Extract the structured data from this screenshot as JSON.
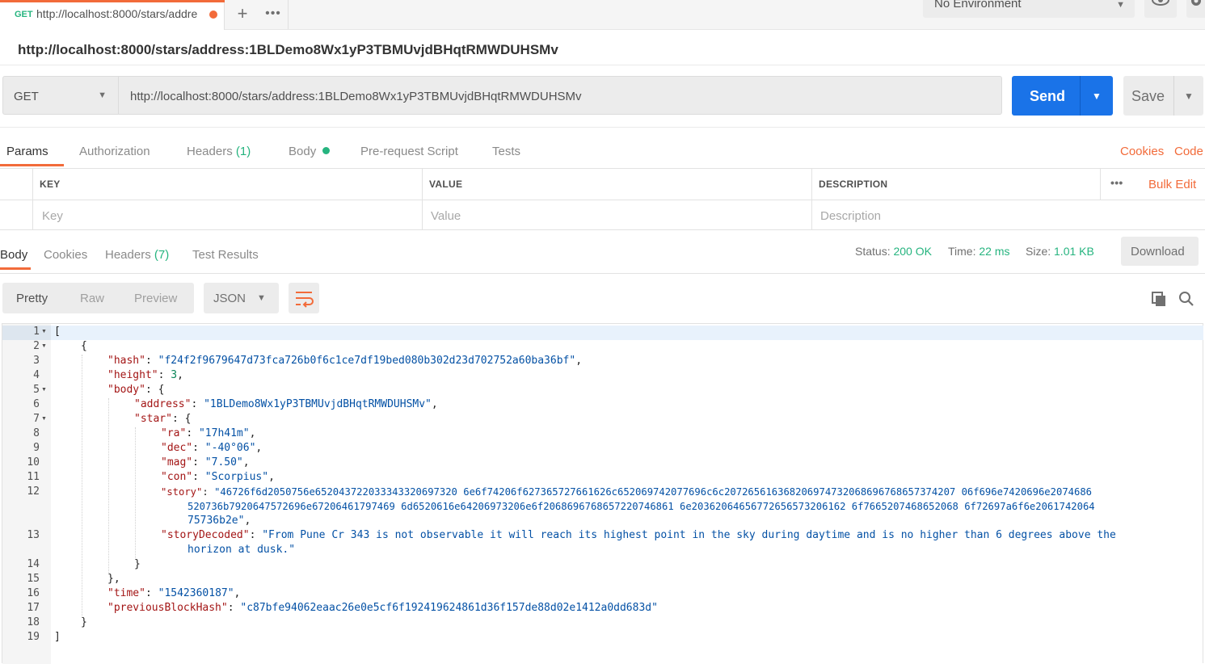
{
  "tabbar": {
    "tab_method": "GET",
    "tab_url": "http://localhost:8000/stars/addre",
    "plus_label": "+",
    "more_label": "•••",
    "environment": "No Environment"
  },
  "page_title": "http://localhost:8000/stars/address:1BLDemo8Wx1yP3TBMUvjdBHqtRMWDUHSMv",
  "request": {
    "method": "GET",
    "url": "http://localhost:8000/stars/address:1BLDemo8Wx1yP3TBMUvjdBHqtRMWDUHSMv",
    "send_label": "Send",
    "save_label": "Save"
  },
  "request_tabs": {
    "params": "Params",
    "authorization": "Authorization",
    "headers": "Headers",
    "headers_count": "(1)",
    "body": "Body",
    "prerequest": "Pre-request Script",
    "tests": "Tests",
    "cookies": "Cookies",
    "code": "Code"
  },
  "params_table": {
    "col_key": "KEY",
    "col_value": "VALUE",
    "col_description": "DESCRIPTION",
    "more": "•••",
    "bulk_edit": "Bulk Edit",
    "ph_key": "Key",
    "ph_value": "Value",
    "ph_description": "Description"
  },
  "response_tabs": {
    "body": "Body",
    "cookies": "Cookies",
    "headers": "Headers",
    "headers_count": "(7)",
    "test_results": "Test Results"
  },
  "response_status": {
    "status_label": "Status:",
    "status_value": "200 OK",
    "time_label": "Time:",
    "time_value": "22 ms",
    "size_label": "Size:",
    "size_value": "1.01 KB",
    "download_label": "Download"
  },
  "view_toolbar": {
    "pretty": "Pretty",
    "raw": "Raw",
    "preview": "Preview",
    "format": "JSON"
  },
  "code": {
    "line_numbers": [
      "1",
      "2",
      "3",
      "4",
      "5",
      "6",
      "7",
      "8",
      "9",
      "10",
      "11",
      "12",
      "13",
      "14",
      "15",
      "16",
      "17",
      "18",
      "19"
    ],
    "l1": "[",
    "l2": "{",
    "hash_key": "\"hash\"",
    "hash_val": "\"f24f2f9679647d73fca726b0f6c1ce7df19bed080b302d23d702752a60ba36bf\"",
    "height_key": "\"height\"",
    "height_val": "3",
    "body_key": "\"body\"",
    "address_key": "\"address\"",
    "address_val": "\"1BLDemo8Wx1yP3TBMUvjdBHqtRMWDUHSMv\"",
    "star_key": "\"star\"",
    "ra_key": "\"ra\"",
    "ra_val": "\"17h41m\"",
    "dec_key": "\"dec\"",
    "dec_val": "\"-40°06\"",
    "mag_key": "\"mag\"",
    "mag_val": "\"7.50\"",
    "con_key": "\"con\"",
    "con_val": "\"Scorpius\"",
    "story_key": "\"story\"",
    "story_val_1": "\"46726f6d2050756e652043722033343320697320 6e6f74206f627365727661626c652069742077696c6c207265616368206974732068696768657374207 06f696e7420696e2074686",
    "story_val_2": "520736b7920647572696e67206461797469 6d6520616e64206973206e6f2068696768657220746861 6e20362064656772656573206162 6f7665207468652068 6f72697a6f6e2061742064",
    "story_val_3": "75736b2e\"",
    "storydecoded_key": "\"storyDecoded\"",
    "storydecoded_val_1": "\"From Pune Cr 343 is not observable it will reach its highest point in the sky during daytime and is no higher than 6 degrees above the",
    "storydecoded_val_2": "horizon at dusk.\"",
    "l14": "}",
    "l15": "},",
    "time_key": "\"time\"",
    "time_val": "\"1542360187\"",
    "prev_key": "\"previousBlockHash\"",
    "prev_val": "\"c87bfe94062eaac26e0e5cf6f192419624861d36f157de88d02e1412a0dd683d\"",
    "l18": "}",
    "l19": "]"
  },
  "colors": {
    "accent": "#f26b3a",
    "send_blue": "#1a73e8",
    "status_green": "#26b47f"
  }
}
